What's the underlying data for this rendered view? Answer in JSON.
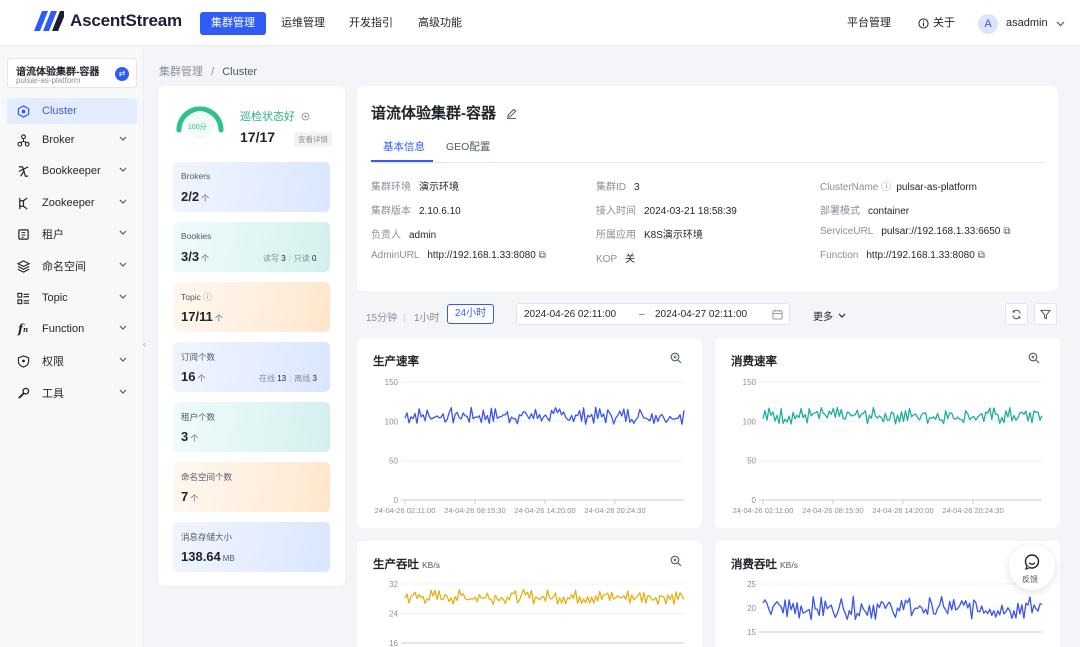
{
  "app": {
    "logo_text": "AscentStream"
  },
  "topnav": [
    {
      "label": "集群管理",
      "active": true
    },
    {
      "label": "运维管理",
      "active": false
    },
    {
      "label": "开发指引",
      "active": false
    },
    {
      "label": "高级功能",
      "active": false
    }
  ],
  "topright": {
    "platform": "平台管理",
    "about": "关于",
    "avatar_letter": "A",
    "user": "asadmin"
  },
  "cluster_selector": {
    "name": "谙流体验集群-容器",
    "sub": "pulsar-as-platform"
  },
  "sidebar": [
    {
      "label": "Cluster",
      "icon": "cluster-icon",
      "active": true
    },
    {
      "label": "Broker",
      "icon": "broker-icon"
    },
    {
      "label": "Bookkeeper",
      "icon": "bookkeeper-icon"
    },
    {
      "label": "Zookeeper",
      "icon": "zookeeper-icon"
    },
    {
      "label": "租户",
      "icon": "tenant-icon"
    },
    {
      "label": "命名空间",
      "icon": "namespace-icon"
    },
    {
      "label": "Topic",
      "icon": "topic-icon"
    },
    {
      "label": "Function",
      "icon": "function-icon"
    },
    {
      "label": "权限",
      "icon": "permission-icon"
    },
    {
      "label": "工具",
      "icon": "tools-icon"
    }
  ],
  "breadcrumb": {
    "parent": "集群管理",
    "sep": "/",
    "current": "Cluster"
  },
  "health": {
    "gauge_label": "100分",
    "score": 100,
    "status": "巡检状态好",
    "ratio": "17/17",
    "detail_btn": "查看详情"
  },
  "stats": {
    "brokers": {
      "label": "Brokers",
      "value": "2/2",
      "unit": "个"
    },
    "bookies": {
      "label": "Bookies",
      "value": "3/3",
      "unit": "个",
      "rw_label": "读写",
      "rw": "3",
      "ro_label": "只读",
      "ro": "0"
    },
    "topic": {
      "label": "Topic",
      "value": "17/11",
      "unit": "个"
    },
    "subs": {
      "label": "订阅个数",
      "value": "16",
      "unit": "个",
      "online_label": "在线",
      "online": "13",
      "offline_label": "离线",
      "offline": "3"
    },
    "tenants": {
      "label": "租户个数",
      "value": "3",
      "unit": "个"
    },
    "namespaces": {
      "label": "命名空间个数",
      "value": "7",
      "unit": "个"
    },
    "storage": {
      "label": "消息存储大小",
      "value": "138.64",
      "unit": "MB"
    }
  },
  "info": {
    "title": "谙流体验集群-容器",
    "tabs": [
      "基本信息",
      "GEO配置"
    ],
    "rows": [
      [
        {
          "k": "集群环境",
          "v": "演示环境"
        },
        {
          "k": "集群ID",
          "v": "3"
        },
        {
          "k": "ClusterName",
          "v": "pulsar-as-platform"
        }
      ],
      [
        {
          "k": "集群版本",
          "v": "2.10.6.10"
        },
        {
          "k": "接入时间",
          "v": "2024-03-21 18:58:39"
        },
        {
          "k": "部署模式",
          "v": "container"
        }
      ],
      [
        {
          "k": "负责人",
          "v": "admin"
        },
        {
          "k": "所属应用",
          "v": "K8S演示环境"
        },
        {
          "k": "ServiceURL",
          "v": "pulsar://192.168.1.33:6650"
        }
      ],
      [
        {
          "k": "AdminURL",
          "v": "http://192.168.1.33:8080"
        },
        {
          "k": "KOP",
          "v": "关"
        },
        {
          "k": "Function",
          "v": "http://192.168.1.33:8080"
        }
      ]
    ]
  },
  "toolbar": {
    "r1": "15分钟",
    "r2": "1小时",
    "r3": "24小时",
    "start": "2024-04-26 02:11:00",
    "dash": "–",
    "end": "2024-04-27 02:11:00",
    "more": "更多"
  },
  "charts": [
    {
      "title": "生产速率",
      "unit": "",
      "color": "#3a55e8"
    },
    {
      "title": "消费速率",
      "unit": "",
      "color": "#1fae9a"
    },
    {
      "title": "生产吞吐",
      "unit": "KB/s",
      "color": "#e6b117"
    },
    {
      "title": "消费吞吐",
      "unit": "KB/s",
      "color": "#3a55e8"
    }
  ],
  "chart_data": [
    {
      "type": "line",
      "title": "生产速率",
      "ylim": [
        0,
        150
      ],
      "yticks": [
        0,
        50,
        100,
        150
      ],
      "series": [
        {
          "color": "#3a55e8",
          "mean": 107,
          "amplitude": 8
        }
      ],
      "x_ticks": [
        "24-04-26 02:11:00",
        "24-04-26 08:15:30",
        "24-04-26 14:20:00",
        "24-04-26 20:24:30"
      ]
    },
    {
      "type": "line",
      "title": "消费速率",
      "ylim": [
        0,
        150
      ],
      "yticks": [
        0,
        50,
        100,
        150
      ],
      "series": [
        {
          "color": "#1fae9a",
          "mean": 107,
          "amplitude": 8
        }
      ],
      "x_ticks": [
        "24-04-26 02:11:00",
        "24-04-26 08:15:30",
        "24-04-26 14:20:00",
        "24-04-26 20:24:30"
      ]
    },
    {
      "type": "line",
      "title": "生产吞吐",
      "ylabel": "KB/s",
      "ylim": [
        16,
        32
      ],
      "yticks": [
        16,
        24,
        32
      ],
      "series": [
        {
          "color": "#e6b117",
          "mean": 28.5,
          "amplitude": 1.5
        }
      ]
    },
    {
      "type": "line",
      "title": "消费吞吐",
      "ylabel": "KB/s",
      "ylim": [
        15,
        25
      ],
      "yticks": [
        15,
        20,
        25
      ],
      "series": [
        {
          "color": "#3a55e8",
          "mean": 20,
          "amplitude": 1.8
        }
      ]
    }
  ],
  "feedback": {
    "label": "反馈"
  }
}
